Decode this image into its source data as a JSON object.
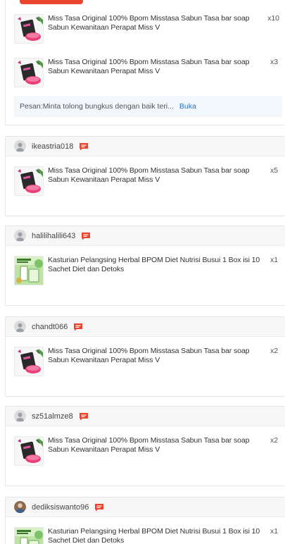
{
  "order_top": {
    "items": [
      {
        "name": "Miss Tasa Original 100% Bpom Misstasa Sabun Tasa bar soap Sabun Kewanitaan Perapat Miss V",
        "qty": "x10",
        "product": "soap"
      },
      {
        "name": "Miss Tasa Original 100% Bpom Misstasa Sabun Tasa bar soap Sabun Kewanitaan Perapat Miss V",
        "qty": "x3",
        "product": "soap"
      }
    ],
    "note_text": "Pesan:Minta tolong bungkus dengan baik teri...",
    "note_link": "Buka"
  },
  "orders": [
    {
      "username": "ikeastria018",
      "item": {
        "name": "Miss Tasa Original 100% Bpom Misstasa Sabun Tasa bar soap Sabun Kewanitaan Perapat Miss V",
        "qty": "x5",
        "product": "soap"
      }
    },
    {
      "username": "halilihalili643",
      "item": {
        "name": "Kasturian Pelangsing Herbal BPOM Diet Nutrisi Busui 1 Box isi 10 Sachet Diet dan Detoks",
        "qty": "x1",
        "product": "kasturian"
      }
    },
    {
      "username": "chandt066",
      "item": {
        "name": "Miss Tasa Original 100% Bpom Misstasa Sabun Tasa bar soap Sabun Kewanitaan Perapat Miss V",
        "qty": "x2",
        "product": "soap"
      }
    },
    {
      "username": "sz51almze8",
      "item": {
        "name": "Miss Tasa Original 100% Bpom Misstasa Sabun Tasa bar soap Sabun Kewanitaan Perapat Miss V",
        "qty": "x2",
        "product": "soap"
      }
    },
    {
      "username": "dediksiswanto96",
      "item": {
        "name": "Kasturian Pelangsing Herbal BPOM Diet Nutrisi Busui 1 Box isi 10 Sachet Diet dan Detoks",
        "qty": "x1",
        "product": "kasturian"
      }
    }
  ],
  "colors": {
    "accent": "#e8452c",
    "link": "#2d6fc4",
    "note_bg": "#f2f7fc"
  },
  "icons": {
    "avatar": "user-avatar-icon",
    "chat": "chat-icon"
  }
}
